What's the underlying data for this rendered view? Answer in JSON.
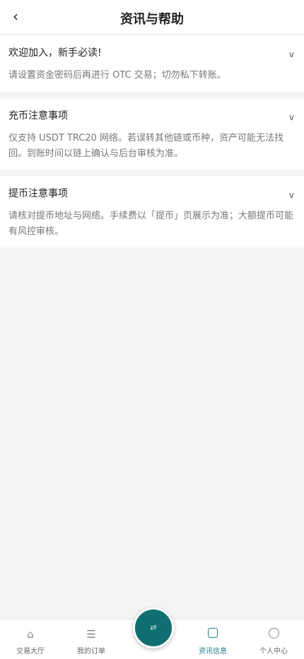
{
  "header": {
    "back_icon": "‹",
    "title": "资讯与帮助"
  },
  "cards": [
    {
      "title": "欢迎加入，新手必读!",
      "body": "请设置资金密码后再进行 OTC 交易；切勿私下转账。",
      "chevron": "v"
    },
    {
      "title": "充币注意事项",
      "body": "仅支持 USDT TRC20 网络。若误转其他链或币种，资产可能无法找回。到账时间以链上确认与后台审核为准。",
      "chevron": "v"
    },
    {
      "title": "提币注意事项",
      "body": "请核对提币地址与网络。手续费以「提币」页展示为准；大额提币可能有风控审核。",
      "chevron": "v"
    }
  ],
  "nav": {
    "items": [
      {
        "label": "交易大厅",
        "icon": "⌂",
        "icon_name": "home-icon"
      },
      {
        "label": "我的订单",
        "icon": "☰",
        "icon_name": "list-icon"
      },
      {
        "label": "资讯信息",
        "icon_name": "square-icon",
        "active": true
      },
      {
        "label": "个人中心",
        "icon_name": "circle-icon"
      }
    ],
    "fab_icon": "⇄"
  },
  "colors": {
    "accent": "#1f7a8c",
    "fab": "#0f6e70",
    "background": "#f4f4f4"
  }
}
